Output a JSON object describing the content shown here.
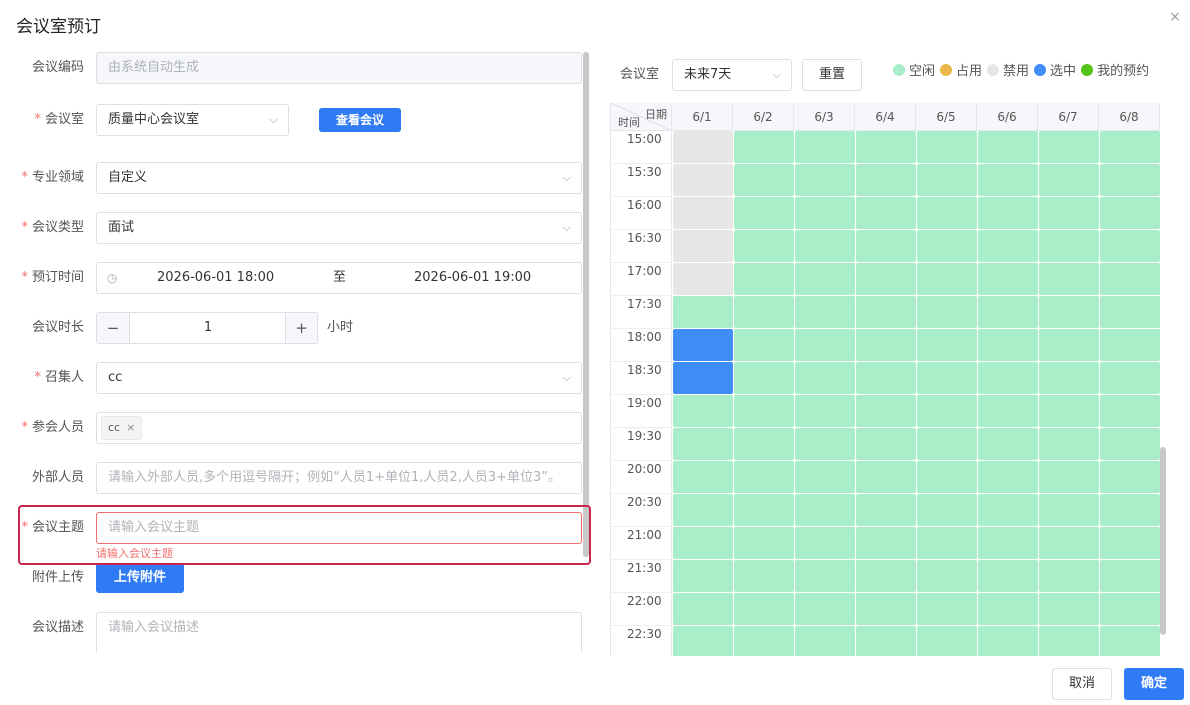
{
  "dialog": {
    "title": "会议室预订",
    "close_icon": "×"
  },
  "form": {
    "code": {
      "label": "会议编码",
      "placeholder": "由系统自动生成"
    },
    "room": {
      "label": "会议室",
      "value": "质量中心会议室",
      "view_button": "查看会议"
    },
    "field": {
      "label": "专业领域",
      "value": "自定义"
    },
    "type": {
      "label": "会议类型",
      "value": "面试"
    },
    "time": {
      "label": "预订时间",
      "start": "2026-06-01 18:00",
      "separator": "至",
      "end": "2026-06-01 19:00"
    },
    "duration": {
      "label": "会议时长",
      "minus": "−",
      "value": "1",
      "plus": "+",
      "unit": "小时"
    },
    "convener": {
      "label": "召集人",
      "value": "cc"
    },
    "attendees": {
      "label": "参会人员",
      "tags": [
        "cc"
      ]
    },
    "external": {
      "label": "外部人员",
      "placeholder": "请输入外部人员,多个用逗号隔开；例如“人员1+单位1,人员2,人员3+单位3”。"
    },
    "subject": {
      "label": "会议主题",
      "placeholder": "请输入会议主题",
      "error": "请输入会议主题"
    },
    "attach": {
      "label": "附件上传",
      "button": "上传附件"
    },
    "desc": {
      "label": "会议描述",
      "placeholder": "请输入会议描述"
    }
  },
  "schedule": {
    "room_label": "会议室",
    "range": "未来7天",
    "reset": "重置",
    "legend": [
      {
        "label": "空闲",
        "color": "#a8eec8"
      },
      {
        "label": "占用",
        "color": "#e8b84a"
      },
      {
        "label": "禁用",
        "color": "#e6e6e6"
      },
      {
        "label": "选中",
        "color": "#3f8ef8"
      },
      {
        "label": "我的预约",
        "color": "#52c41a"
      }
    ],
    "corner_date": "日期",
    "corner_time": "时间",
    "dates": [
      "6/1",
      "6/2",
      "6/3",
      "6/4",
      "6/5",
      "6/6",
      "6/7",
      "6/8"
    ],
    "times": [
      "15:00",
      "15:30",
      "16:00",
      "16:30",
      "17:00",
      "17:30",
      "18:00",
      "18:30",
      "19:00",
      "19:30",
      "20:00",
      "20:30",
      "21:00",
      "21:30",
      "22:00",
      "22:30",
      ""
    ],
    "first_day_status": [
      "disabled",
      "disabled",
      "disabled",
      "disabled",
      "disabled",
      "free",
      "selected",
      "selected",
      "free",
      "free",
      "free",
      "free",
      "free",
      "free",
      "free",
      "free",
      "free"
    ]
  },
  "footer": {
    "cancel": "取消",
    "confirm": "确定"
  }
}
